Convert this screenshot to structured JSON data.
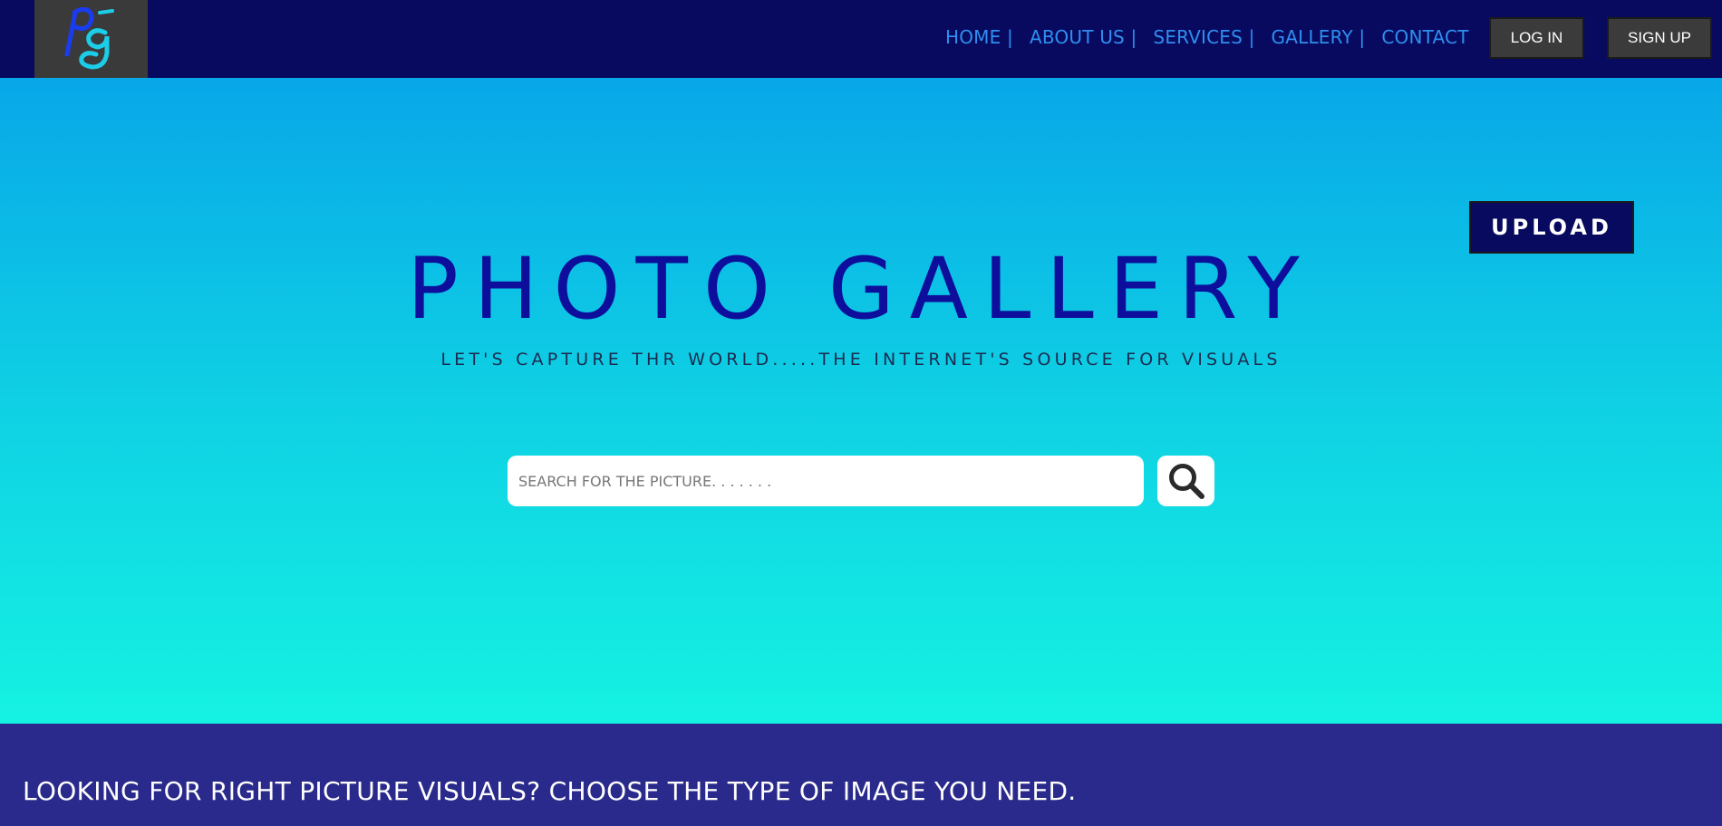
{
  "header": {
    "logo_text": "pg",
    "nav": [
      {
        "label": "HOME |"
      },
      {
        "label": "ABOUT US |"
      },
      {
        "label": "SERVICES |"
      },
      {
        "label": "GALLERY |"
      },
      {
        "label": "CONTACT"
      }
    ],
    "login_label": "LOG IN",
    "signup_label": "SIGN UP"
  },
  "hero": {
    "upload_label": "UPLOAD",
    "title": "PHOTO GALLERY",
    "subtitle": "LET'S CAPTURE THR WORLD.....THE INTERNET'S SOURCE FOR VISUALS",
    "search": {
      "placeholder": "SEARCH FOR THE PICTURE. . . . . . .",
      "value": "",
      "button_icon": "search-icon"
    }
  },
  "section": {
    "heading": "LOOKING FOR RIGHT PICTURE VISUALS? CHOOSE THE TYPE OF IMAGE YOU NEED."
  },
  "colors": {
    "header_bg": "#070a5f",
    "nav_link": "#2f8ff0",
    "hero_top": "#08a7e8",
    "hero_bottom": "#15f2e2",
    "title": "#0d0f9c",
    "bottom_bg": "#2a2a8c",
    "button_dark": "#3b3b3b"
  }
}
